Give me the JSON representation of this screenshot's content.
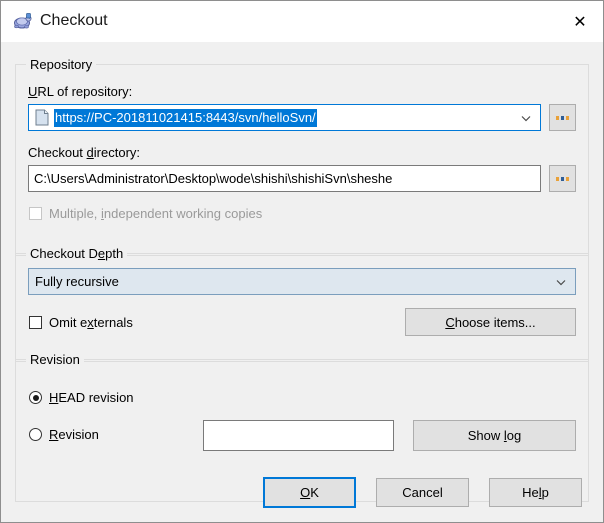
{
  "window": {
    "title": "Checkout",
    "icon": "tortoise-svn-icon",
    "close_label": "✕",
    "accent_color": "#0078d7",
    "body_color": "#f0f0f0"
  },
  "repository": {
    "group_label": "Repository",
    "url_label_pre": "U",
    "url_label_post": "RL of repository:",
    "url_value": "https://PC-201811021415:8443/svn/helloSvn/",
    "url_selected": true,
    "url_icon": "document-icon",
    "url_dropdown_icon": "chevron-down-icon",
    "url_browse_label": "...",
    "dir_label_pre": "Checkout ",
    "dir_label_acc": "d",
    "dir_label_post": "irectory:",
    "dir_value": "C:\\Users\\Administrator\\Desktop\\wode\\shishi\\shishiSvn\\sheshe",
    "dir_browse_label": "...",
    "multiple_pre": "Multiple, ",
    "multiple_acc": "i",
    "multiple_post": "ndependent working copies",
    "multiple_checked": false,
    "multiple_enabled": false
  },
  "depth": {
    "group_label_pre": "Checkout D",
    "group_label_acc": "e",
    "group_label_post": "pth",
    "selected_option": "Fully recursive",
    "dropdown_icon": "chevron-down-icon",
    "omit_pre": "Omit e",
    "omit_acc": "x",
    "omit_post": "ternals",
    "omit_checked": false,
    "choose_items_acc": "C",
    "choose_items_post": "hoose items..."
  },
  "revision": {
    "group_label": "Revision",
    "head_acc": "H",
    "head_post": "EAD revision",
    "head_selected": true,
    "rev_acc": "R",
    "rev_post": "evision",
    "rev_selected": false,
    "rev_value": "",
    "show_log_pre": "Show ",
    "show_log_acc": "l",
    "show_log_post": "og"
  },
  "footer": {
    "ok_acc": "O",
    "ok_post": "K",
    "cancel_label": "Cancel",
    "help_pre": "He",
    "help_acc": "l",
    "help_post": "p"
  }
}
